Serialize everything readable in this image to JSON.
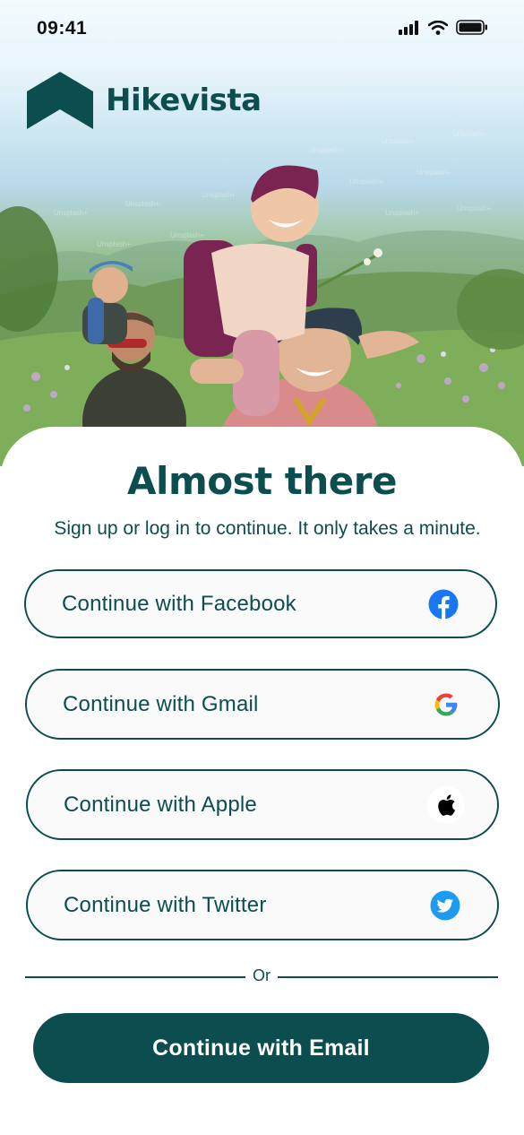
{
  "status_bar": {
    "time": "09:41",
    "icons": [
      "cellular-signal-icon",
      "wifi-icon",
      "battery-icon"
    ]
  },
  "brand": {
    "name": "Hikevista",
    "logo_icon": "house-chevron-logo",
    "color": "#0c4d4f"
  },
  "hero": {
    "description_icon": "family-hiking-photo"
  },
  "auth": {
    "title": "Almost there",
    "subtitle": "Sign up or log in to continue. It only takes a minute.",
    "providers": [
      {
        "label": "Continue with Facebook",
        "icon": "facebook-icon",
        "color": "#1877f2"
      },
      {
        "label": "Continue with Gmail",
        "icon": "google-icon",
        "color": "#4285f4"
      },
      {
        "label": "Continue with Apple",
        "icon": "apple-icon",
        "color": "#000000"
      },
      {
        "label": "Continue with Twitter",
        "icon": "twitter-icon",
        "color": "#1d9bf0"
      }
    ],
    "divider_text": "Or",
    "email_button": "Continue with Email"
  }
}
